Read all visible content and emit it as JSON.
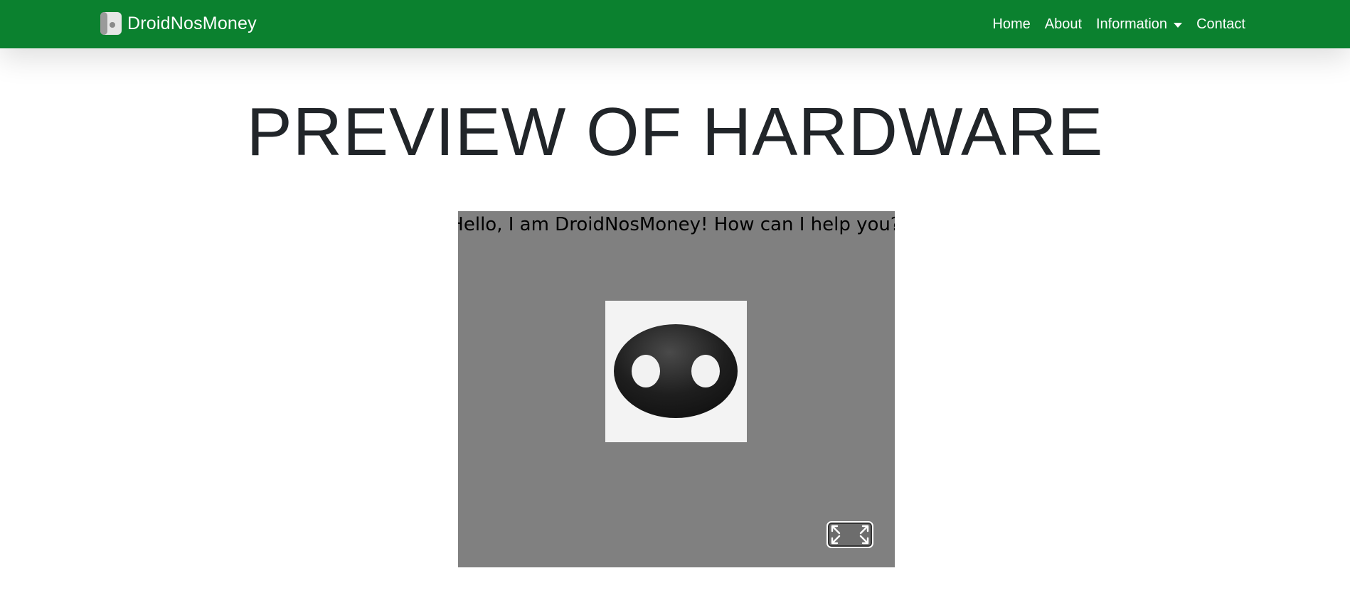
{
  "navbar": {
    "brand": "DroidNosMoney",
    "items": [
      {
        "label": "Home"
      },
      {
        "label": "About"
      },
      {
        "label": "Information"
      },
      {
        "label": "Contact"
      }
    ]
  },
  "colors": {
    "navbar_bg": "#0b812f",
    "preview_bg": "#808080",
    "title_text": "#212529"
  },
  "icons": {
    "brand_logo": "droid-logo-icon",
    "dropdown": "chevron-down-icon",
    "fullscreen": "expand-icon",
    "robot_face": "robot-face-image"
  },
  "main": {
    "title": "PREVIEW OF HARDWARE",
    "greeting": "Hello, I am DroidNosMoney! How can I help you?"
  }
}
